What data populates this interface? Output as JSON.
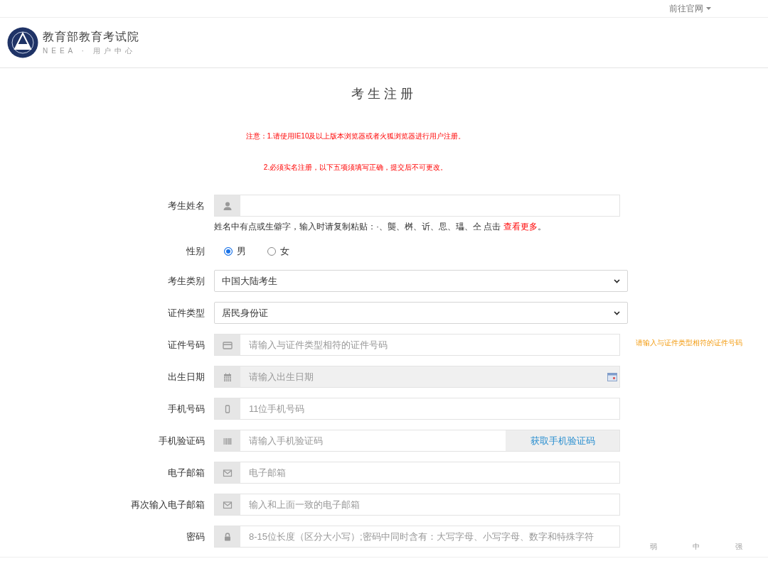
{
  "top_bar": {
    "link": "前往官网"
  },
  "header": {
    "title": "教育部教育考试院",
    "subtitle": "NEEA · 用户中心"
  },
  "page_title": "考生注册",
  "notices": [
    "注意：1.请使用IE10及以上版本浏览器或者火狐浏览器进行用户注册。",
    "2.必须实名注册，以下五项须填写正确，提交后不可更改。"
  ],
  "fields": [
    {
      "kind": "text",
      "label": "考生姓名",
      "note": "姓名中有点或生僻字，输入时请复制粘贴：·、龑、桝、䜣、㤙、瓃、仝 点击 ",
      "note_link": "查看更多",
      "note_end": "。"
    },
    {
      "kind": "radio",
      "label": "性别",
      "options": [
        {
          "label": "男",
          "selected": true
        },
        {
          "label": "女",
          "selected": false
        }
      ]
    },
    {
      "kind": "select",
      "label": "考生类别",
      "value": "中国大陆考生"
    },
    {
      "kind": "select",
      "label": "证件类型",
      "value": "居民身份证"
    },
    {
      "kind": "text",
      "label": "证件号码",
      "placeholder": "请输入与证件类型相符的证件号码",
      "side_hint": "请输入与证件类型相符的证件号码"
    },
    {
      "kind": "date",
      "label": "出生日期",
      "placeholder": "请输入出生日期"
    },
    {
      "kind": "text",
      "label": "手机号码",
      "placeholder": "11位手机号码"
    },
    {
      "kind": "code",
      "label": "手机验证码",
      "placeholder": "请输入手机验证码",
      "button": "获取手机验证码"
    },
    {
      "kind": "text",
      "label": "电子邮箱",
      "placeholder": "电子邮箱"
    },
    {
      "kind": "text",
      "label": "再次输入电子邮箱",
      "placeholder": "输入和上面一致的电子邮箱"
    },
    {
      "kind": "password",
      "label": "密码",
      "placeholder": "8-15位长度（区分大小写）;密码中同时含有：大写字母、小写字母、数字和特殊字符",
      "strength": [
        "弱",
        "中",
        "强"
      ]
    }
  ]
}
